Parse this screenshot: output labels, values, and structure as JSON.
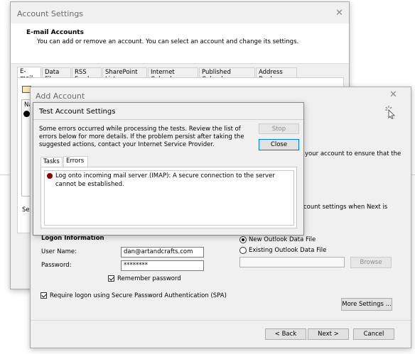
{
  "account_settings": {
    "title": "Account Settings",
    "heading": "E-mail Accounts",
    "description": "You can add or remove an account. You can select an account and change its settings.",
    "tabs": [
      "E-mail",
      "Data Files",
      "RSS Feeds",
      "SharePoint Lists",
      "Internet Calendars",
      "Published Calendars",
      "Address Books"
    ],
    "partial_list_header": "Na",
    "partial_left_text": "Sele"
  },
  "add_account": {
    "title": "Add Account",
    "right_text_1": "your account to ensure that the",
    "right_text_2": "count settings when Next is",
    "logon_heading": "Logon Information",
    "user_name_label": "User Name:",
    "user_name_value": "dan@artandcrafts.com",
    "password_label": "Password:",
    "password_value": "********",
    "remember_password": "Remember password",
    "spa_label": "Require logon using Secure Password Authentication (SPA)",
    "new_data_file": "New Outlook Data File",
    "existing_data_file": "Existing Outlook Data File",
    "browse_button": "Browse",
    "more_settings_button": "More Settings ...",
    "back_button": "< Back",
    "next_button": "Next >",
    "cancel_button": "Cancel"
  },
  "test_settings": {
    "title": "Test Account Settings",
    "message": "Some errors occurred while processing the tests. Review the list of errors below for more details. If the problem persist after taking the suggested actions, contact your Internet Service Provider.",
    "stop_button": "Stop",
    "close_button": "Close",
    "tabs": [
      "Tasks",
      "Errors"
    ],
    "error_text": "Log onto incoming mail server (IMAP): A secure connection to the server cannot be established."
  }
}
